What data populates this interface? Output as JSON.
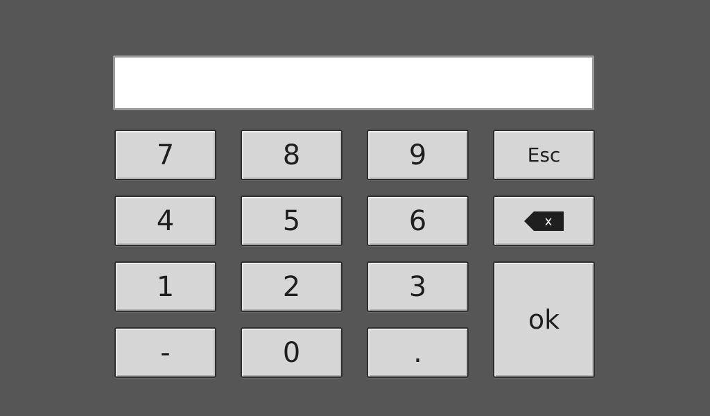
{
  "display": {
    "value": ""
  },
  "keys": {
    "k7": "7",
    "k8": "8",
    "k9": "9",
    "esc": "Esc",
    "k4": "4",
    "k5": "5",
    "k6": "6",
    "backspace_icon": "backspace-icon",
    "backspace_glyph": "x",
    "k1": "1",
    "k2": "2",
    "k3": "3",
    "ok": "ok",
    "minus": "-",
    "k0": "0",
    "dot": "."
  },
  "colors": {
    "background": "#565656",
    "key_face": "#d6d6d6",
    "key_border": "#2f2f2f",
    "display_bg": "#ffffff",
    "display_border": "#9a9a9a",
    "text": "#1f1f1f"
  }
}
